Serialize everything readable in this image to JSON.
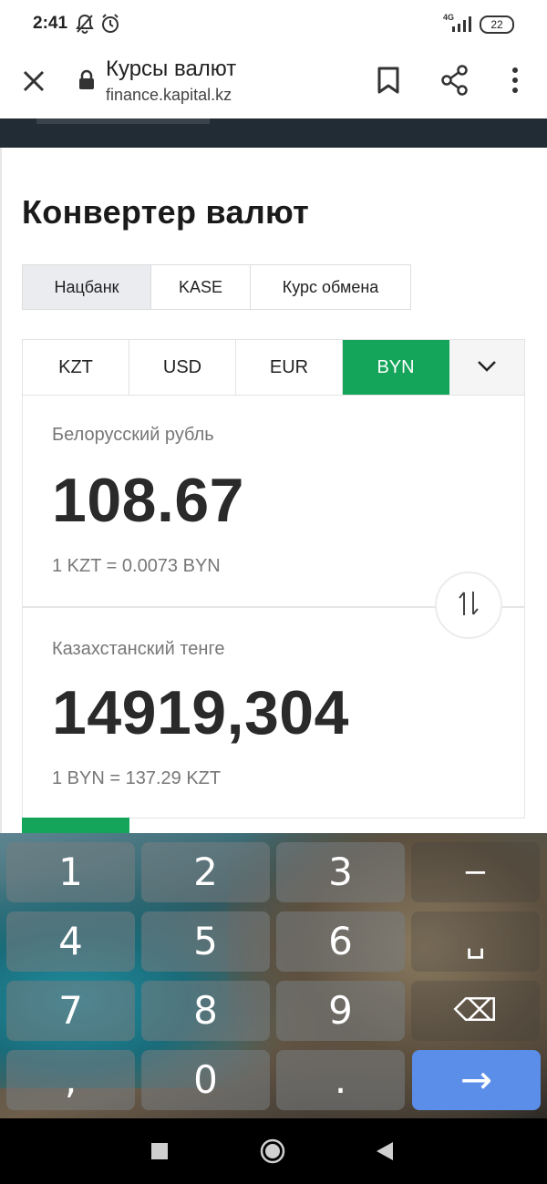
{
  "status_bar": {
    "time": "2:41",
    "network": "4G",
    "battery": "22",
    "icons": [
      "mute-notifications-icon",
      "alarm-icon",
      "signal-icon",
      "battery-icon"
    ]
  },
  "browser_bar": {
    "title": "Курсы валют",
    "url": "finance.kapital.kz",
    "icons": [
      "close-icon",
      "lock-icon",
      "bookmark-icon",
      "share-icon",
      "more-icon"
    ]
  },
  "converter": {
    "heading": "Конвертер валют",
    "source_tabs": [
      {
        "label": "Нацбанк",
        "active": true
      },
      {
        "label": "KASE",
        "active": false
      },
      {
        "label": "Курс обмена",
        "active": false
      }
    ],
    "currency_tabs": [
      {
        "label": "KZT",
        "active": false
      },
      {
        "label": "USD",
        "active": false
      },
      {
        "label": "EUR",
        "active": false
      },
      {
        "label": "BYN",
        "active": true
      }
    ],
    "top_panel": {
      "currency_name": "Белорусский рубль",
      "amount": "108.67",
      "rate": "1 KZT = 0.0073 BYN"
    },
    "bottom_panel": {
      "currency_name": "Казахстанский тенге",
      "amount": "14919,304",
      "rate": "1 BYN = 137.29 KZT"
    }
  },
  "keyboard": {
    "keys": [
      "1",
      "2",
      "3",
      "−",
      "4",
      "5",
      "6",
      "␣",
      "7",
      "8",
      "9",
      "⌫",
      ",",
      "0",
      ".",
      "→"
    ]
  },
  "colors": {
    "accent_green": "#15a55a",
    "dark_header": "#222c35",
    "enter_key": "#5b8ee8"
  }
}
